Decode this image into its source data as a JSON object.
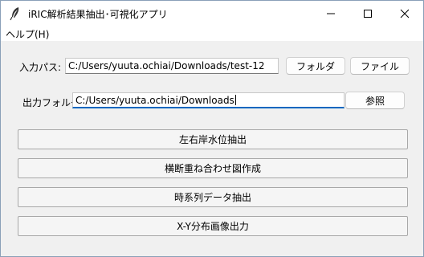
{
  "window": {
    "title": "iRIC解析結果抽出･可視化アプリ"
  },
  "menu": {
    "items": [
      {
        "label": "ヘルプ(H)"
      }
    ]
  },
  "input": {
    "label": "入力パス:",
    "value": "C:/Users/yuuta.ochiai/Downloads/test-12",
    "folder_button": "フォルダ",
    "file_button": "ファイル"
  },
  "output": {
    "label": "出力フォルダ:",
    "value": "C:/Users/yuuta.ochiai/Downloads",
    "browse_button": "参照"
  },
  "actions": [
    {
      "label": "左右岸水位抽出"
    },
    {
      "label": "横断重ね合わせ図作成"
    },
    {
      "label": "時系列データ抽出"
    },
    {
      "label": "X-Y分布画像出力"
    }
  ]
}
